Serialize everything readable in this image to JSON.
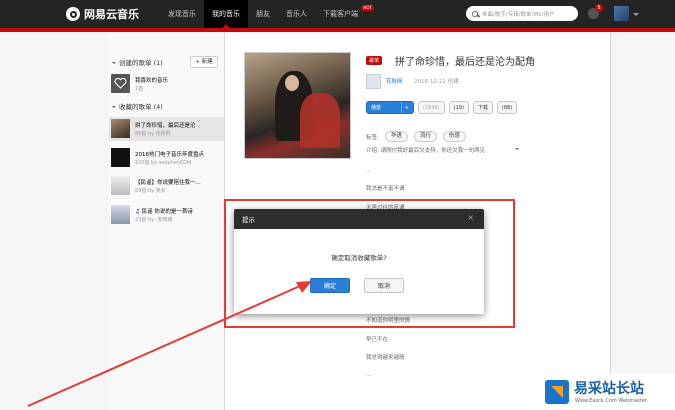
{
  "header": {
    "app_name": "网易云音乐",
    "nav": [
      {
        "label": "发现音乐",
        "active": false,
        "hot": false
      },
      {
        "label": "我的音乐",
        "active": true,
        "hot": false
      },
      {
        "label": "朋友",
        "active": false,
        "hot": false
      },
      {
        "label": "音乐人",
        "active": false,
        "hot": false
      },
      {
        "label": "下载客户端",
        "active": false,
        "hot": true
      }
    ],
    "hot_badge": "HOT",
    "search_placeholder": "单曲/歌手/专辑/歌单/MV/用户",
    "notification_count": "5",
    "accent_color": "#c20c0c"
  },
  "sidebar": {
    "created_header": "创建的歌单 (1)",
    "new_button": "+ 新建",
    "created": [
      {
        "title": "我喜欢的音乐",
        "sub": "1首"
      }
    ],
    "collected_header": "收藏的歌单 (4)",
    "collected": [
      {
        "title": "拼了命珍惜，最后还是沦",
        "sub": "66首 by 花秋网",
        "selected": true
      },
      {
        "title": "2016热门电子音乐年度盘点",
        "sub": "100首 by welphenEDM",
        "selected": false
      },
      {
        "title": "【民谣】你说要陪住我一...",
        "sub": "69首 by 我女",
        "selected": false
      },
      {
        "title": "♫ 民谣 你说的是一首诗",
        "sub": "23首 by -安晓南",
        "selected": false
      }
    ]
  },
  "playlist": {
    "tag": "歌单",
    "title": "拼了命珍惜，最后还是沦为配角",
    "creator": "花秋网",
    "created": "2016-12-21 创建",
    "buttons": {
      "play": "播放",
      "play_add": "+",
      "collect": "(2836)",
      "share": "(19)",
      "download": "下载",
      "comment": "(88)"
    },
    "tags_label": "标签:",
    "tags": [
      "华语",
      "流行",
      "伤感"
    ],
    "intro": "介绍: 请刚付我好最后欠支持，你还欠我一句两见",
    "lyrics_top": [
      "...",
      "我总是不富不谓",
      "无声过往的富谓"
    ],
    "lyrics_bottom": [
      "不知道你明里的情",
      "早已不在",
      "我总得越来越晴",
      "..."
    ]
  },
  "dialog": {
    "title": "提示",
    "close": "×",
    "message": "确定取消收藏歌单?",
    "ok": "确定",
    "cancel": "取消"
  },
  "watermark": {
    "text": "易采站长站",
    "url": "Www.Easck.Com Webmaster"
  }
}
